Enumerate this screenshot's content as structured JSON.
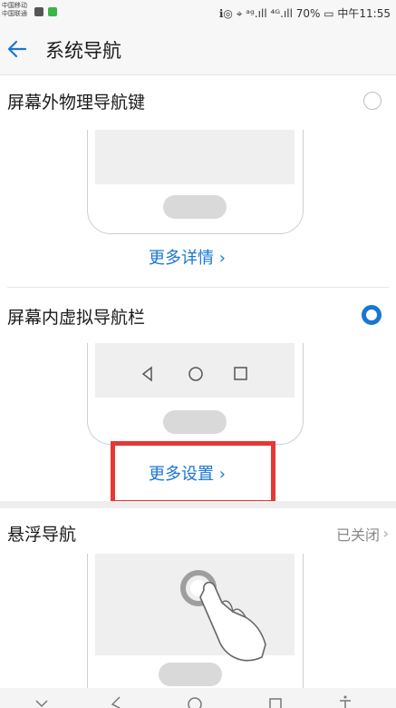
{
  "status_bar": {
    "carrier1": "中国移动",
    "carrier2": "中国联通",
    "right": "ℹ◎ ⌖ ᵃᵍ.ıll ⁴ᴳ.ıll 70% ▭ 中午11:55"
  },
  "header": {
    "title": "系统导航",
    "back_icon": "arrow-left-icon"
  },
  "sections": [
    {
      "title": "屏幕外物理导航键",
      "selected": false,
      "link": "更多详情 ›"
    },
    {
      "title": "屏幕内虚拟导航栏",
      "selected": true,
      "link": "更多设置 ›"
    },
    {
      "title": "悬浮导航",
      "status": "已关闭",
      "chevron": "›"
    }
  ],
  "colors": {
    "accent": "#1976d2",
    "highlight": "#e53935"
  }
}
